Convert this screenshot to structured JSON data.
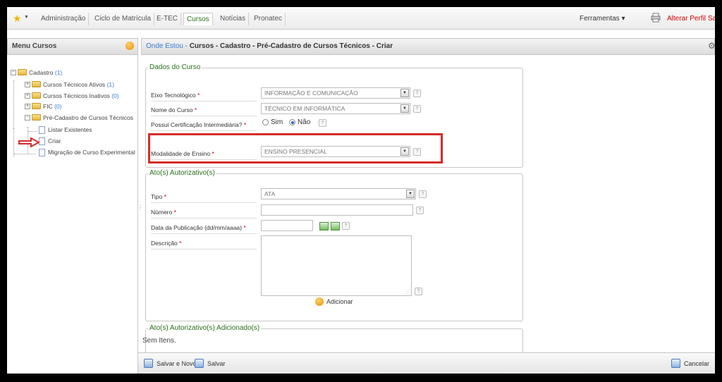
{
  "topnav": {
    "tabs": [
      {
        "label": "Administração"
      },
      {
        "label": "Ciclo de Matrícula"
      },
      {
        "label": "E-TEC"
      },
      {
        "label": "Cursos"
      },
      {
        "label": "Notícias"
      },
      {
        "label": "Pronatec"
      }
    ],
    "active_tab": "Cursos",
    "tools_label": "Ferramentas ▾",
    "alter_profile": "Alterar Perfil",
    "logout_partial": "Sa"
  },
  "sidebar": {
    "title": "Menu Cursos",
    "tree": {
      "cadastro": {
        "label": "Cadastro",
        "count": "(1)"
      },
      "ativos": {
        "label": "Cursos Técnicos Ativos",
        "count": "(1)"
      },
      "inativos": {
        "label": "Cursos Técnicos Inativos",
        "count": "(0)"
      },
      "fic": {
        "label": "FIC",
        "count": "(0)"
      },
      "pre_cadastro": {
        "label": "Pré-Cadastro de Cursos Técnicos"
      },
      "listar": {
        "label": "Listar Existentes"
      },
      "criar": {
        "label": "Criar"
      },
      "migracao": {
        "label": "Migração de Curso Experimental"
      }
    }
  },
  "breadcrumb": {
    "here": "Onde Estou -",
    "path": "Cursos  - Cadastro - Pré-Cadastro de Cursos Técnicos - Criar"
  },
  "dados_curso": {
    "legend": "Dados do Curso",
    "eixo": {
      "label": "Eixo Tecnológico",
      "value": "INFORMAÇÃO E COMUNICAÇÃO"
    },
    "nome": {
      "label": "Nome do Curso",
      "value": "TÉCNICO EM INFORMÁTICA"
    },
    "certificacao": {
      "label": "Possui Certificação Intermediária?",
      "opt_sim": "Sim",
      "opt_nao": "Não",
      "selected": "Não"
    },
    "modalidade": {
      "label": "Modalidade de Ensino",
      "value": "ENSINO PRESENCIAL"
    }
  },
  "atos": {
    "legend": "Ato(s) Autorizativo(s)",
    "tipo": {
      "label": "Tipo",
      "value": "ATA"
    },
    "numero": {
      "label": "Número",
      "value": ""
    },
    "data": {
      "label": "Data da Publicação (dd/mm/aaaa)",
      "value": ""
    },
    "descricao": {
      "label": "Descrição",
      "value": ""
    },
    "add_label": "Adicionar"
  },
  "atos_adicionados": {
    "legend": "Ato(s) Autorizativo(s) Adicionado(s)",
    "empty_text": "Sem Itens."
  },
  "bottom": {
    "save_new": "Salvar e Novo",
    "save": "Salvar",
    "cancel": "Cancelar"
  },
  "common": {
    "required_mark": "*",
    "help_mark": "?"
  },
  "colors": {
    "accent_green": "#2a6f1a",
    "link_blue": "#3a7bd5",
    "highlight_red": "#d62b2b"
  }
}
